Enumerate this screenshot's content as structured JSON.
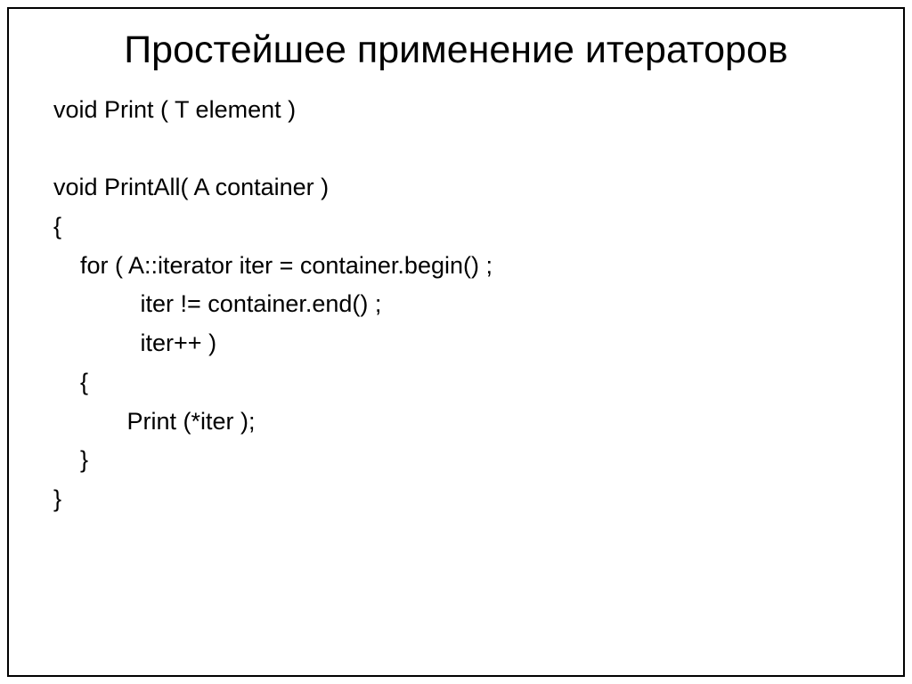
{
  "slide": {
    "title": "Простейшее применение итераторов",
    "code": {
      "line1": "void Print ( T element )",
      "blank1": "",
      "line2": "void PrintAll( A container )",
      "line3": "{",
      "line4": "    for ( A::iterator iter = container.begin() ;",
      "line5": "             iter != container.end() ;",
      "line6": "             iter++ )",
      "line7": "    {",
      "line8": "           Print (*iter );",
      "line9": "    }",
      "line10": "}"
    }
  }
}
